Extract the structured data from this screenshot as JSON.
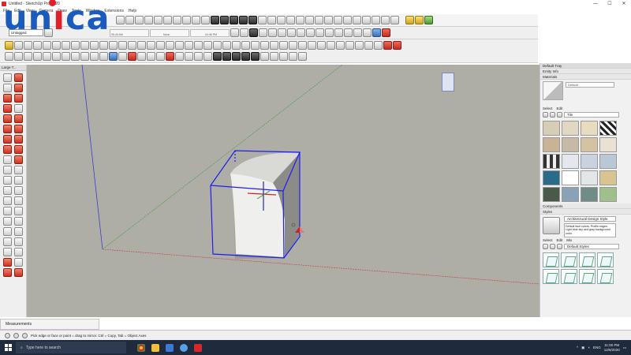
{
  "window": {
    "title": "Untitled - SketchUp Pro 2020",
    "controls": [
      "—",
      "☐",
      "✕"
    ]
  },
  "logo": {
    "text_prefix": "un",
    "text_suffix": "ca",
    "brand_color": "#1a5bbd",
    "accent_color": "#e0202a"
  },
  "menu": [
    "File",
    "Edit",
    "View",
    "Camera",
    "Draw",
    "Tools",
    "Window",
    "Extensions",
    "Help"
  ],
  "toolbar": {
    "layer_value": "Untagged",
    "shadow_time_left": "06:43 AM",
    "shadow_time_mid": "Noon",
    "shadow_time_right": "04:46 PM"
  },
  "left_panel": {
    "title": "Large T..."
  },
  "tray": {
    "title": "Default Tray",
    "entity_info": "Entity Info",
    "materials": "Materials",
    "material_name": "Default",
    "tab_select": "Select",
    "tab_edit": "Edit",
    "material_collection": "Tile",
    "components": "Components",
    "styles": "Styles",
    "style_name": "Architectural Design Style",
    "style_desc": "Default face colors. Profile edges. Light blue sky and gray background color.",
    "styles_tab_select": "Select",
    "styles_tab_edit": "Edit",
    "styles_tab_mix": "Mix",
    "styles_collection": "Default Styles"
  },
  "measurements": {
    "label": "Measurements"
  },
  "status": {
    "hint": "Pick edge or face or point = drag to mirror. Ctrl = Copy, Tab = Object Axes"
  },
  "taskbar": {
    "search_placeholder": "Type here to search",
    "language": "ENG",
    "clock_time": "11:00 PM",
    "clock_date": "12/6/2020"
  }
}
